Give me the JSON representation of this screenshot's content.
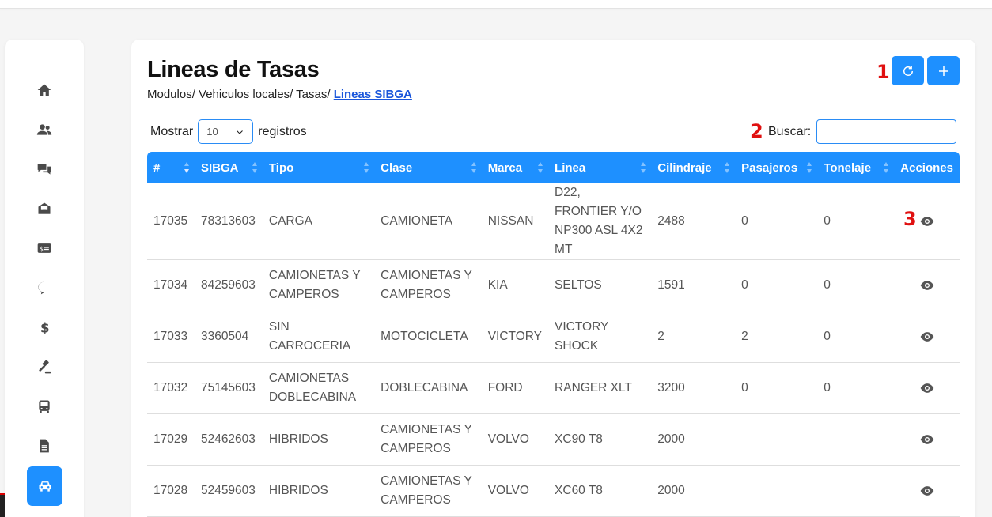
{
  "page": {
    "title": "Lineas de Tasas",
    "breadcrumb": {
      "path": "Modulos/ Vehiculos locales/ Tasas/ ",
      "current": "Lineas SIBGA"
    }
  },
  "markers": {
    "m1": "1",
    "m2": "2",
    "m3": "3"
  },
  "toolbar": {
    "refresh_icon": "refresh-icon",
    "add_icon": "plus-icon"
  },
  "controls": {
    "show_label": "Mostrar",
    "show_value": "10",
    "records_label": "registros",
    "search_label": "Buscar:",
    "search_value": ""
  },
  "sidebar": {
    "items": [
      {
        "icon": "home-icon"
      },
      {
        "icon": "users-icon"
      },
      {
        "icon": "chat-icon"
      },
      {
        "icon": "inbox-icon"
      },
      {
        "icon": "money-card-icon"
      },
      {
        "icon": "coin-bubble-icon"
      },
      {
        "icon": "dollar-icon"
      },
      {
        "icon": "gavel-icon"
      },
      {
        "icon": "bus-icon"
      },
      {
        "icon": "document-icon"
      },
      {
        "icon": "car-icon",
        "active": true
      }
    ]
  },
  "table": {
    "headers": [
      "#",
      "SIBGA",
      "Tipo",
      "Clase",
      "Marca",
      "Linea",
      "Cilindraje",
      "Pasajeros",
      "Tonelaje",
      "Acciones"
    ],
    "rows": [
      [
        "17035",
        "78313603",
        "CARGA",
        "CAMIONETA",
        "NISSAN",
        "D22, FRONTIER Y/O NP300 ASL 4X2 MT",
        "2488",
        "0",
        "0"
      ],
      [
        "17034",
        "84259603",
        "CAMIONETAS Y CAMPEROS",
        "CAMIONETAS Y CAMPEROS",
        "KIA",
        "SELTOS",
        "1591",
        "0",
        "0"
      ],
      [
        "17033",
        "3360504",
        "SIN CARROCERIA",
        "MOTOCICLETA",
        "VICTORY",
        "VICTORY SHOCK",
        "2",
        "2",
        "0"
      ],
      [
        "17032",
        "75145603",
        "CAMIONETAS DOBLECABINA",
        "DOBLECABINA",
        "FORD",
        "RANGER XLT",
        "3200",
        "0",
        "0"
      ],
      [
        "17029",
        "52462603",
        "HIBRIDOS",
        "CAMIONETAS Y CAMPEROS",
        "VOLVO",
        "XC90 T8",
        "2000",
        "",
        ""
      ],
      [
        "17028",
        "52459603",
        "HIBRIDOS",
        "CAMIONETAS Y CAMPEROS",
        "VOLVO",
        "XC60 T8",
        "2000",
        "",
        ""
      ]
    ],
    "action_icon": "eye-icon"
  },
  "colors": {
    "primary": "#1e90ff",
    "marker": "#e01010"
  }
}
